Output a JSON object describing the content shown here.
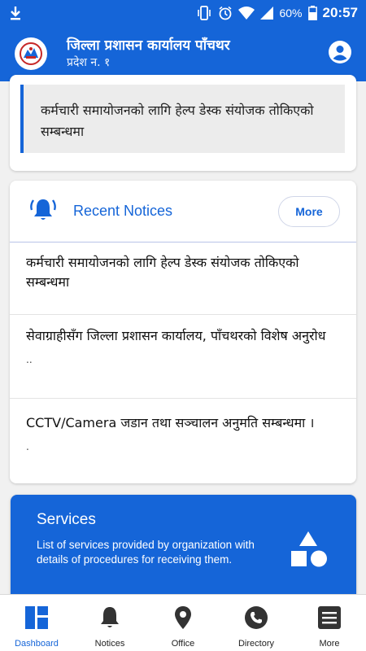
{
  "status_bar": {
    "battery": "60%",
    "time": "20:57",
    "icons": [
      "download-icon",
      "vibrate-icon",
      "alarm-icon",
      "wifi-icon",
      "signal-icon",
      "battery-icon"
    ]
  },
  "app_bar": {
    "title": "जिल्ला प्रशासन कार्यालय पाँचथर",
    "subtitle": "प्रदेश न. १",
    "logo": "emblem-logo",
    "account_icon": "account-circle-icon"
  },
  "top_card": {
    "notice": "कर्मचारी समायोजनको लागि हेल्प डेस्क संयोजक तोकिएको सम्बन्धमा"
  },
  "recent_notices": {
    "title": "Recent Notices",
    "more_label": "More",
    "icon": "bell-ringing-icon",
    "items": [
      {
        "text": "कर्मचारी समायोजनको लागि हेल्प डेस्क संयोजक तोकिएको सम्बन्धमा",
        "excerpt": ""
      },
      {
        "text": "सेवाग्राहीसँग जिल्ला प्रशासन कार्यालय, पाँचथरको विशेष अनुरोध",
        "excerpt": ".."
      },
      {
        "text": "CCTV/Camera जडान तथा सञ्चालन अनुमति सम्बन्धमा ।",
        "excerpt": "."
      }
    ]
  },
  "services": {
    "title": "Services",
    "description": "List of services provided by organization with details of procedures for receiving them.",
    "icon": "shapes-icon"
  },
  "bottom_nav": {
    "items": [
      {
        "label": "Dashboard",
        "icon": "dashboard-icon",
        "active": true
      },
      {
        "label": "Notices",
        "icon": "bell-icon",
        "active": false
      },
      {
        "label": "Office",
        "icon": "location-pin-icon",
        "active": false
      },
      {
        "label": "Directory",
        "icon": "phone-icon",
        "active": false
      },
      {
        "label": "More",
        "icon": "menu-icon",
        "active": false
      }
    ]
  },
  "colors": {
    "primary": "#1565d8",
    "background": "#f1f1f1",
    "card": "#ffffff",
    "notice_highlight": "#ececec"
  }
}
